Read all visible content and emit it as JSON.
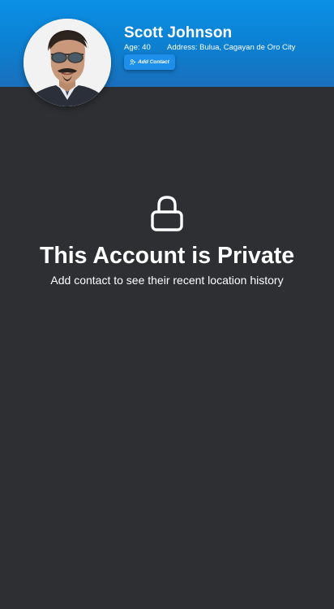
{
  "profile": {
    "name": "Scott Johnson",
    "age": "Age: 40",
    "address": "Address: Bulua, Cagayan de Oro City",
    "add_contact_label": "Add Contact",
    "avatar_icon": "profile-photo"
  },
  "private_notice": {
    "icon": "lock-icon",
    "title": "This Account is Private",
    "subtitle": "Add contact to see their recent location history"
  },
  "colors": {
    "header": "#0d7fd0",
    "background": "#2d2f33",
    "button": "#1d8fea",
    "text": "#ffffff"
  }
}
